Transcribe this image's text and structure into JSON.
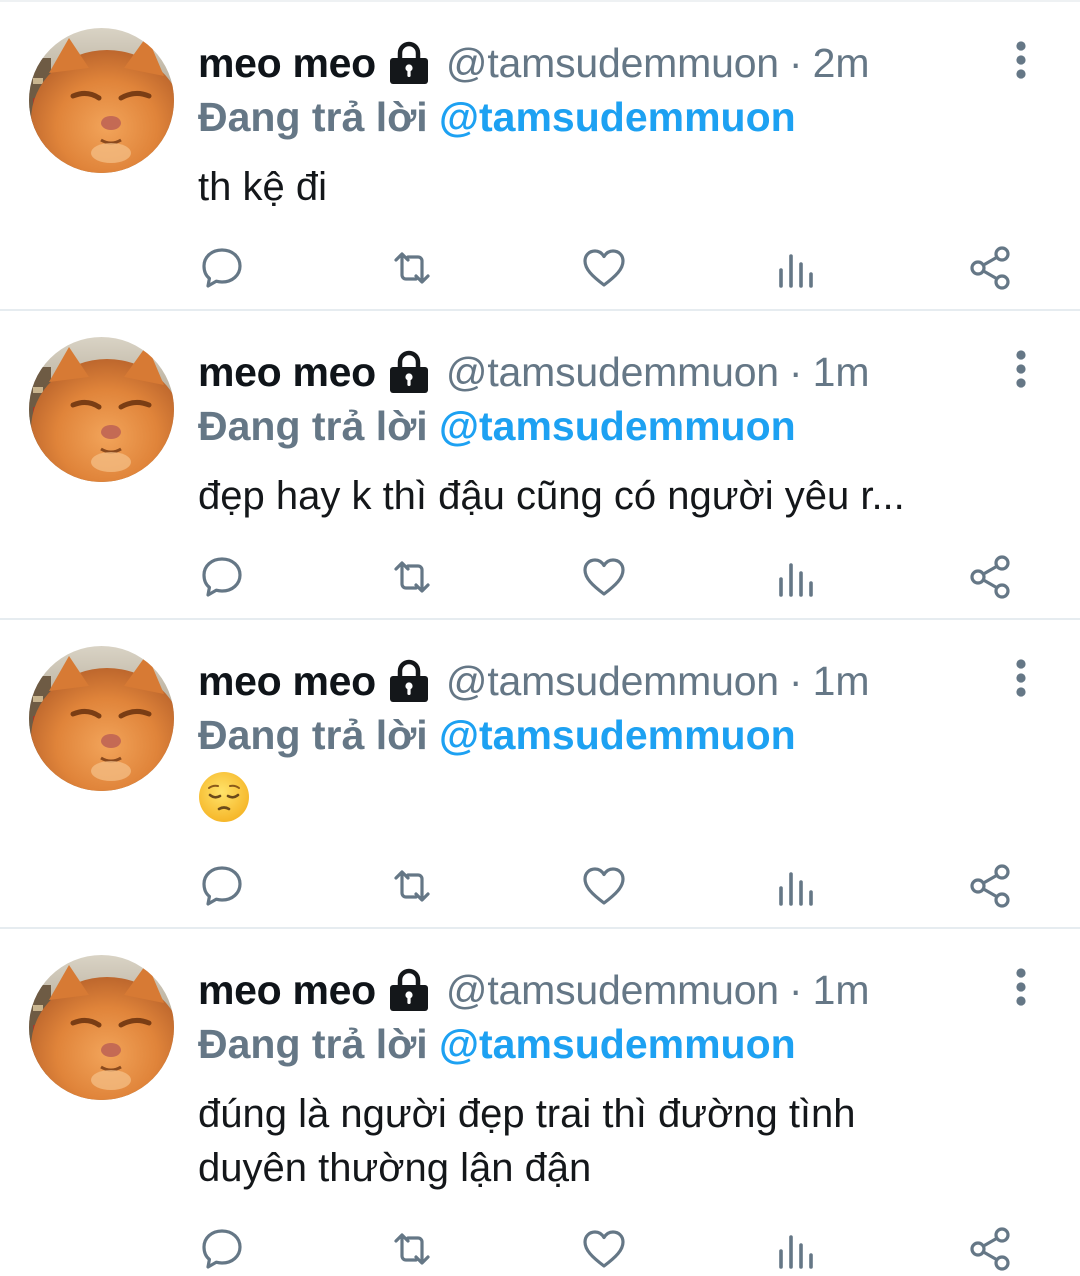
{
  "tweets": [
    {
      "name": "meo meo",
      "handle": "@tamsudemmuon",
      "separator": "·",
      "time": "2m",
      "reply_label": "Đang trả lời",
      "reply_to": "@tamsudemmuon",
      "text": "th kệ đi"
    },
    {
      "name": "meo meo",
      "handle": "@tamsudemmuon",
      "separator": "·",
      "time": "1m",
      "reply_label": "Đang trả lời",
      "reply_to": "@tamsudemmuon",
      "text": "đẹp hay k thì đậu cũng có người yêu r..."
    },
    {
      "name": "meo meo",
      "handle": "@tamsudemmuon",
      "separator": "·",
      "time": "1m",
      "reply_label": "Đang trả lời",
      "reply_to": "@tamsudemmuon",
      "text": "",
      "emoji": "pensive-face"
    },
    {
      "name": "meo meo",
      "handle": "@tamsudemmuon",
      "separator": "·",
      "time": "1m",
      "reply_label": "Đang trả lời",
      "reply_to": "@tamsudemmuon",
      "text": "đúng là người đẹp trai thì đường tình\nduyên thường lận đận"
    }
  ],
  "icons": {
    "protected": "lock-icon",
    "more": "more-vertical-icon",
    "actions": [
      "reply-icon",
      "retweet-icon",
      "like-icon",
      "analytics-icon",
      "share-icon"
    ]
  },
  "colors": {
    "text": "#14171a",
    "secondary": "#657786",
    "link": "#1da1f2",
    "divider": "#e6ecf0"
  }
}
